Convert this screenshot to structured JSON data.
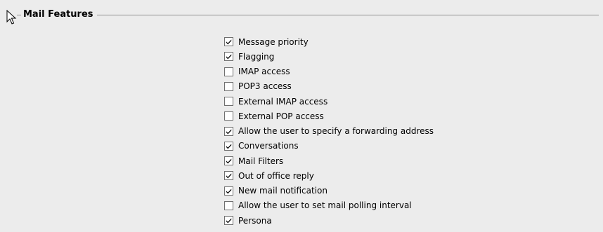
{
  "section": {
    "title": "Mail Features"
  },
  "features": [
    {
      "label": "Message priority",
      "checked": true
    },
    {
      "label": "Flagging",
      "checked": true
    },
    {
      "label": "IMAP access",
      "checked": false
    },
    {
      "label": "POP3 access",
      "checked": false
    },
    {
      "label": "External IMAP access",
      "checked": false
    },
    {
      "label": "External POP access",
      "checked": false
    },
    {
      "label": "Allow the user to specify a forwarding address",
      "checked": true
    },
    {
      "label": "Conversations",
      "checked": true
    },
    {
      "label": "Mail Filters",
      "checked": true
    },
    {
      "label": "Out of office reply",
      "checked": true
    },
    {
      "label": "New mail notification",
      "checked": true
    },
    {
      "label": "Allow the user to set mail polling interval",
      "checked": false
    },
    {
      "label": "Persona",
      "checked": true
    }
  ],
  "icons": {
    "cursor": "mouse-pointer-icon",
    "check": "checkmark-icon"
  }
}
